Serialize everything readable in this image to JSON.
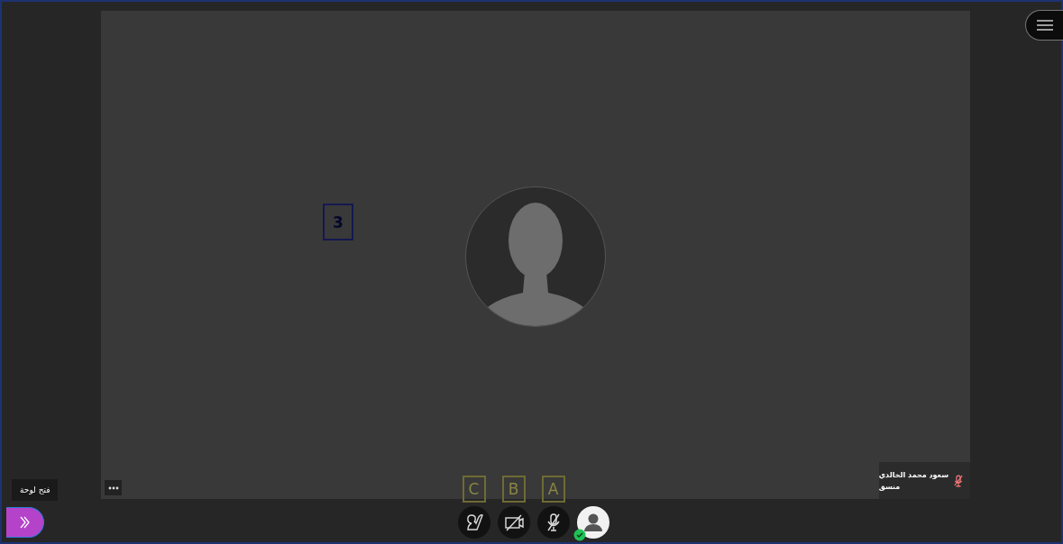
{
  "stage": {
    "annotation": "3",
    "participant": {
      "name": "سعود محمد الخالدي",
      "role": "منسق",
      "muted": true
    }
  },
  "panel_toggle": {
    "tooltip": "فتح لوحة"
  },
  "controls": [
    {
      "kind": "avatar",
      "online": true
    },
    {
      "kind": "mic",
      "annotation": "A",
      "off": true
    },
    {
      "kind": "camera",
      "annotation": "B",
      "off": true
    },
    {
      "kind": "share",
      "annotation": "C"
    }
  ]
}
